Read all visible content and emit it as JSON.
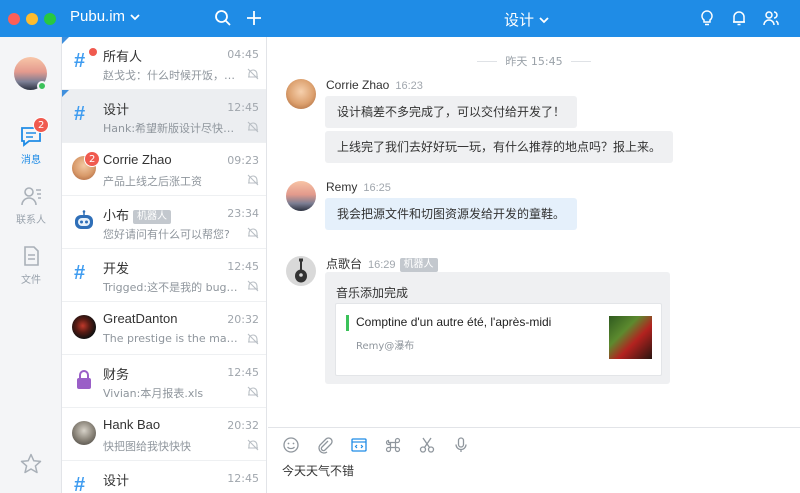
{
  "window": {
    "team_name": "Pubu.im",
    "channel_title": "设计"
  },
  "rail": {
    "items": [
      {
        "label": "消息",
        "badge": "2",
        "icon": "message-icon",
        "active": true
      },
      {
        "label": "联系人",
        "icon": "contacts-icon"
      },
      {
        "label": "文件",
        "icon": "file-icon"
      }
    ],
    "bottom_icon": "star-icon"
  },
  "conversations": [
    {
      "name": "所有人",
      "time": "04:45",
      "preview": "赵戈戈：什么时候开饭，我饿...",
      "type": "channel",
      "unread_dot": true
    },
    {
      "name": "设计",
      "time": "12:45",
      "preview": "Hank:希望新版设计尽快上线",
      "type": "channel",
      "selected": true
    },
    {
      "name": "Corrie Zhao",
      "time": "09:23",
      "preview": "产品上线之后涨工资",
      "type": "user",
      "badge": "2"
    },
    {
      "name": "小布",
      "tag": "机器人",
      "time": "23:34",
      "preview": "您好请问有什么可以帮您?",
      "type": "bot"
    },
    {
      "name": "开发",
      "time": "12:45",
      "preview": "Trigged:这不是我的 bug，不...",
      "type": "channel"
    },
    {
      "name": "GreatDanton",
      "time": "20:32",
      "preview": "The prestige is the magic",
      "type": "user"
    },
    {
      "name": "财务",
      "time": "12:45",
      "preview": "Vivian:本月报表.xls",
      "type": "private"
    },
    {
      "name": "Hank Bao",
      "time": "20:32",
      "preview": "快把图给我快快快",
      "type": "user"
    },
    {
      "name": "设计",
      "time": "12:45",
      "preview": "",
      "type": "channel"
    }
  ],
  "chat": {
    "day_separator": "昨天 15:45",
    "messages": [
      {
        "sender": "Corrie Zhao",
        "time": "16:23",
        "bubbles": [
          "设计稿差不多完成了，可以交付给开发了！",
          "上线完了我们去好好玩一玩，有什么推荐的地点吗？报上来。"
        ]
      },
      {
        "sender": "Remy",
        "time": "16:25",
        "bubbles": [
          "我会把源文件和切图资源发给开发的童鞋。"
        ]
      },
      {
        "sender": "点歌台",
        "time": "16:29",
        "tag": "机器人",
        "card_title": "音乐添加完成",
        "song": "Comptine d'un autre été, l'après-midi",
        "song_meta": "Remy@瀑布"
      }
    ]
  },
  "composer": {
    "text": "今天天气不错",
    "tools": [
      "emoji-icon",
      "attach-icon",
      "code-icon",
      "command-icon",
      "scissors-icon",
      "microphone-icon"
    ]
  },
  "colors": {
    "brand": "#1f8ce6",
    "badge": "#f05a4f",
    "online": "#3bc25a",
    "channel_hash": "#3f9cf0"
  }
}
